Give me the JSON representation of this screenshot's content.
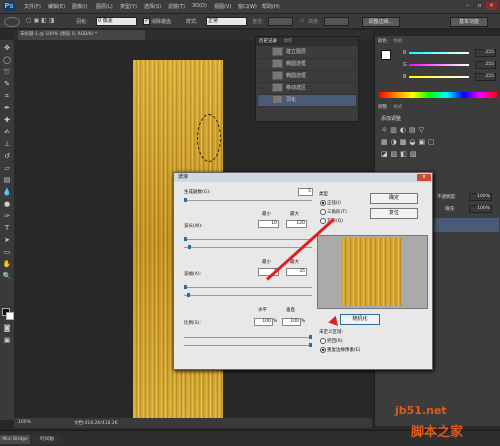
{
  "app": {
    "logo": "Ps"
  },
  "menu": [
    "文件(F)",
    "编辑(E)",
    "图像(I)",
    "图层(L)",
    "类型(Y)",
    "选择(S)",
    "滤镜(T)",
    "3D(D)",
    "视图(V)",
    "窗口(W)",
    "帮助(H)"
  ],
  "options": {
    "feather_label": "羽化:",
    "feather_value": "0 像素",
    "antialias_label": "消除锯齿",
    "style_label": "样式:",
    "style_value": "正常",
    "width_label": "宽度:",
    "height_label": "高度:",
    "refine_button": "调整边缘...",
    "workspace": "基本功能"
  },
  "document": {
    "tab": "未标题-1 @ 100% (图层 0, RGB/8) *",
    "zoom": "100%",
    "doc_info": "文档:418.2K/418.2K"
  },
  "history": {
    "tabs": [
      "历史记录",
      "动作"
    ],
    "items": [
      "建立图层",
      "椭圆选框",
      "椭圆选框",
      "移动选区",
      "羽化"
    ]
  },
  "right_panel": {
    "color_tabs": [
      "颜色",
      "色板"
    ],
    "r_label": "R",
    "g_label": "G",
    "b_label": "B",
    "r_value": "255",
    "g_value": "255",
    "b_value": "255",
    "adjust_tabs": [
      "调整",
      "样式"
    ],
    "adjust_title": "添加调整",
    "layers_opacity_label": "不透明度:",
    "layers_opacity_value": "100%",
    "layers_fill_label": "填充:",
    "layers_fill_value": "100%"
  },
  "minibridge": {
    "tabs": [
      "Mini Bridge",
      "时间轴"
    ]
  },
  "dialog": {
    "title": "波浪",
    "generators_label": "生成器数(G):",
    "generators_value": "5",
    "wavelength_label": "波长(W):",
    "min_label": "最小",
    "max_label": "最大",
    "wavelength_min": "10",
    "wavelength_max": "120",
    "amplitude_label": "波幅(A):",
    "amplitude_min": "5",
    "amplitude_max": "35",
    "scale_label": "比例(S):",
    "horizontal_label": "水平",
    "vertical_label": "垂直",
    "scale_h": "100",
    "scale_v": "100",
    "percent": "%",
    "type_label": "类型",
    "type_sine": "正弦(I)",
    "type_triangle": "三角形(T)",
    "type_square": "方形(Q)",
    "ok_button": "确定",
    "reset_button": "复位",
    "randomize_button": "随机化",
    "undefined_label": "未定义区域:",
    "wrap_around": "折回(R)",
    "repeat_edge": "重复边缘像素(E)"
  },
  "watermark": {
    "site": "jb51.net",
    "name": "脚本之家"
  },
  "colors": {
    "accent": "#e02020",
    "ps_blue": "#6fb3f2"
  }
}
